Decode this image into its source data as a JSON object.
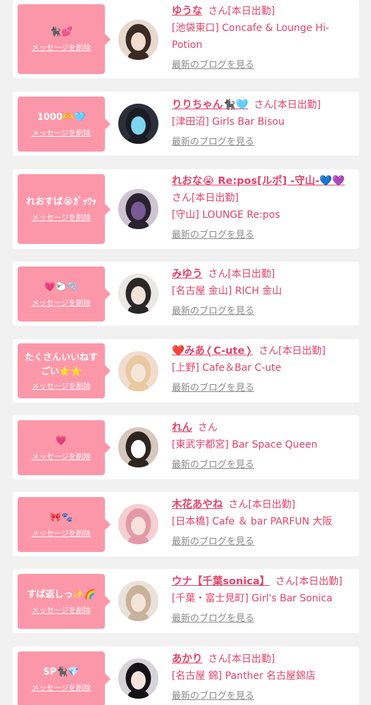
{
  "entries": [
    {
      "message": "🐈‍⬛💕",
      "delete_label": "メッセージを削除",
      "name": "ゆうな",
      "honorific": "さん[本日出勤]",
      "shop": "[池袋東口] Concafe & Lounge Hi-Potion",
      "blog_label": "最新のブログを見る",
      "avatar_palette": [
        "#e8d9cf",
        "#3a2a24",
        "#f3dccd"
      ]
    },
    {
      "message": "1000🫶🩵",
      "delete_label": "メッセージを削除",
      "name": "りりちゃん🐈‍⬛🩵",
      "honorific": "さん[本日出勤]",
      "shop": "[津田沼] Girls Bar Bisou",
      "blog_label": "最新のブログを見る",
      "avatar_palette": [
        "#2b2f3a",
        "#1b1b24",
        "#7fd4f2"
      ]
    },
    {
      "message": "れおすば😭ｶﾞｯﾜｯ",
      "delete_label": "メッセージを削除",
      "name": "れおな😭 Re:pos[ルポ] -守山-💙💜",
      "honorific": "さん[本日出勤]",
      "shop": "[守山] LOUNGE Re:pos",
      "blog_label": "最新のブログを見る",
      "avatar_palette": [
        "#cfc4d2",
        "#2a2230",
        "#7a5a92"
      ]
    },
    {
      "message": "💗🐑🫧",
      "delete_label": "メッセージを削除",
      "name": "みゆう",
      "honorific": "さん[本日出勤]",
      "shop": "[名古屋 金山] RICH 金山",
      "blog_label": "最新のブログを見る",
      "avatar_palette": [
        "#ebe7e6",
        "#2a2628",
        "#f2e1d8"
      ]
    },
    {
      "message": "たくさんいいねすごい⭐⭐",
      "delete_label": "メッセージを削除",
      "name": "❤️みあ❬C-ute❭",
      "honorific": "さん[本日出勤]",
      "shop": "[上野] Cafe＆Bar C-ute",
      "blog_label": "最新のブログを見る",
      "avatar_palette": [
        "#f1dccf",
        "#e9c9a0",
        "#f6e5d9"
      ]
    },
    {
      "message": "💗",
      "delete_label": "メッセージを削除",
      "name": "れん",
      "honorific": "さん",
      "shop": "[東武宇都宮] Bar Space Queen",
      "blog_label": "最新のブログを見る",
      "avatar_palette": [
        "#d6c7bf",
        "#2e2421",
        "#ffffff"
      ]
    },
    {
      "message": "🎀🐾",
      "delete_label": "メッセージを削除",
      "name": "木花あやね",
      "honorific": "さん[本日出勤]",
      "shop": "[日本橋] Cafe ＆ bar PARFUN 大阪",
      "blog_label": "最新のブログを見る",
      "avatar_palette": [
        "#f6cfd2",
        "#e39aa8",
        "#f7e1da"
      ]
    },
    {
      "message": "すば返しっ✨🌈",
      "delete_label": "メッセージを削除",
      "name": "ウナ【千葉sonica】",
      "honorific": "さん[本日出勤]",
      "shop": "[千葉・富士見町] Girl's Bar Sonica",
      "blog_label": "最新のブログを見る",
      "avatar_palette": [
        "#e9e1da",
        "#c8b29a",
        "#f3e3d8"
      ]
    },
    {
      "message": "SP🐈‍⬛💎",
      "delete_label": "メッセージを削除",
      "name": "あかり",
      "honorific": "さん[本日出勤]",
      "shop": "[名古屋 錦] Panther 名古屋錦店",
      "blog_label": "最新のブログを見る",
      "avatar_palette": [
        "#d8d3d6",
        "#141216",
        "#f4e2dc"
      ]
    }
  ]
}
